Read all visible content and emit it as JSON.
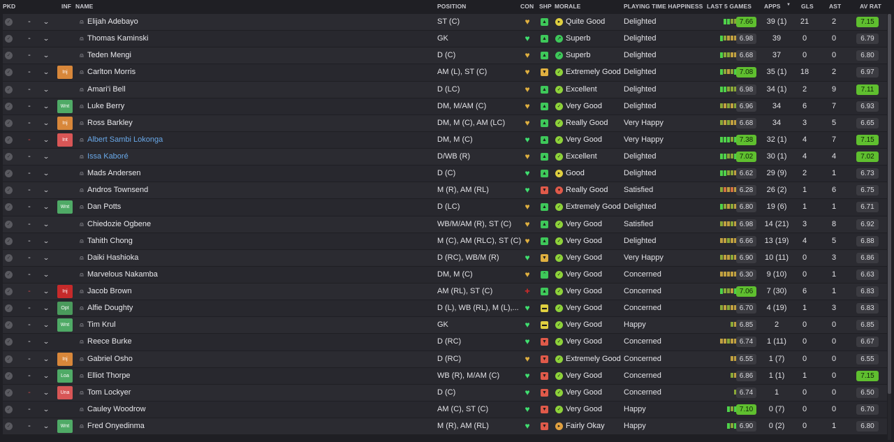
{
  "headers": {
    "pkd": "PKD",
    "inf": "INF",
    "name": "NAME",
    "position": "POSITION",
    "con": "CON",
    "shp": "SHP",
    "morale": "MORALE",
    "playing_time": "PLAYING TIME HAPPINESS",
    "last5": "LAST 5 GAMES",
    "apps": "APPS",
    "gls": "GLS",
    "ast": "AST",
    "av_rat": "AV RAT"
  },
  "colors": {
    "good_rating": "#5fbf2f",
    "form_high": "#4fd24a",
    "form_mid": "#8aa838",
    "form_low": "#c0a040",
    "form_bad": "#d07040",
    "condition_good": "#40e070",
    "condition_warn": "#e0b040",
    "injury_badge": "#d8873a",
    "wanted_badge": "#4faa66",
    "international_badge": "#d85656",
    "loaned_name": "#69a8e8"
  },
  "players": [
    {
      "pkd_dash": "-",
      "red": false,
      "inf": "",
      "name": "Elijah Adebayo",
      "loan": false,
      "position": "ST (C)",
      "con": "warn",
      "shp": "up",
      "morale_icon": "quite",
      "morale": "Quite Good",
      "playing_time": "Delighted",
      "last5": [
        "h",
        "h",
        "m",
        "m"
      ],
      "last_rating": "7.66",
      "last_good": true,
      "apps": "39 (1)",
      "gls": "21",
      "ast": "2",
      "avrat": "7.15",
      "av_good": true
    },
    {
      "pkd_dash": "-",
      "red": false,
      "inf": "",
      "name": "Thomas Kaminski",
      "loan": false,
      "position": "GK",
      "con": "good",
      "shp": "up",
      "morale_icon": "super",
      "morale": "Superb",
      "playing_time": "Delighted",
      "last5": [
        "h",
        "m",
        "l",
        "l",
        "l"
      ],
      "last_rating": "6.98",
      "last_good": false,
      "apps": "39",
      "gls": "0",
      "ast": "0",
      "avrat": "6.79",
      "av_good": false
    },
    {
      "pkd_dash": "-",
      "red": false,
      "inf": "",
      "name": "Teden Mengi",
      "loan": false,
      "position": "D (C)",
      "con": "warn",
      "shp": "up",
      "morale_icon": "super",
      "morale": "Superb",
      "playing_time": "Delighted",
      "last5": [
        "h",
        "m",
        "m",
        "l",
        "l"
      ],
      "last_rating": "6.68",
      "last_good": false,
      "apps": "37",
      "gls": "0",
      "ast": "0",
      "avrat": "6.80",
      "av_good": false
    },
    {
      "pkd_dash": "-",
      "red": false,
      "inf": "Inj",
      "inf_type": "inj",
      "name": "Carlton Morris",
      "loan": false,
      "position": "AM (L), ST (C)",
      "con": "warn",
      "shp": "warnup",
      "morale_icon": "good",
      "morale": "Extremely Good",
      "playing_time": "Delighted",
      "last5": [
        "h",
        "m",
        "l",
        "m",
        "h"
      ],
      "last_rating": "7.08",
      "last_good": true,
      "apps": "35 (1)",
      "gls": "18",
      "ast": "2",
      "avrat": "6.97",
      "av_good": false
    },
    {
      "pkd_dash": "-",
      "red": false,
      "inf": "",
      "name": "Amari'i Bell",
      "loan": false,
      "position": "D (LC)",
      "con": "warn",
      "shp": "up",
      "morale_icon": "good",
      "morale": "Excellent",
      "playing_time": "Delighted",
      "last5": [
        "h",
        "h",
        "m",
        "m",
        "m"
      ],
      "last_rating": "6.98",
      "last_good": false,
      "apps": "34 (1)",
      "gls": "2",
      "ast": "9",
      "avrat": "7.11",
      "av_good": true
    },
    {
      "pkd_dash": "-",
      "red": false,
      "inf": "Wnt",
      "inf_type": "wnt",
      "name": "Luke Berry",
      "loan": false,
      "position": "DM, M/AM (C)",
      "con": "warn",
      "shp": "up",
      "morale_icon": "good",
      "morale": "Very Good",
      "playing_time": "Delighted",
      "last5": [
        "m",
        "l",
        "m",
        "l",
        "m"
      ],
      "last_rating": "6.96",
      "last_good": false,
      "apps": "34",
      "gls": "6",
      "ast": "7",
      "avrat": "6.93",
      "av_good": false
    },
    {
      "pkd_dash": "-",
      "red": false,
      "inf": "Inj",
      "inf_type": "inj",
      "name": "Ross Barkley",
      "loan": false,
      "position": "DM, M (C), AM (LC)",
      "con": "warn",
      "shp": "up",
      "morale_icon": "good",
      "morale": "Really Good",
      "playing_time": "Very Happy",
      "last5": [
        "m",
        "l",
        "m",
        "l",
        "l"
      ],
      "last_rating": "6.68",
      "last_good": false,
      "apps": "34",
      "gls": "3",
      "ast": "5",
      "avrat": "6.65",
      "av_good": false
    },
    {
      "pkd_dash": "-",
      "red": true,
      "inf": "Int",
      "inf_type": "int",
      "name": "Albert Sambi Lokonga",
      "loan": true,
      "position": "DM, M (C)",
      "con": "good",
      "shp": "up",
      "morale_icon": "good",
      "morale": "Very Good",
      "playing_time": "Very Happy",
      "last5": [
        "h",
        "h",
        "h",
        "m",
        "h"
      ],
      "last_rating": "7.38",
      "last_good": true,
      "apps": "32 (1)",
      "gls": "4",
      "ast": "7",
      "avrat": "7.15",
      "av_good": true
    },
    {
      "pkd_dash": "-",
      "red": false,
      "inf": "",
      "name": "Issa Kaboré",
      "loan": true,
      "position": "D/WB (R)",
      "con": "warn",
      "shp": "up",
      "morale_icon": "good",
      "morale": "Excellent",
      "playing_time": "Delighted",
      "last5": [
        "h",
        "h",
        "m",
        "m",
        "h"
      ],
      "last_rating": "7.02",
      "last_good": true,
      "apps": "30 (1)",
      "gls": "4",
      "ast": "4",
      "avrat": "7.02",
      "av_good": true
    },
    {
      "pkd_dash": "-",
      "red": false,
      "inf": "",
      "name": "Mads Andersen",
      "loan": false,
      "position": "D (C)",
      "con": "good",
      "shp": "up",
      "morale_icon": "quite",
      "morale": "Good",
      "playing_time": "Delighted",
      "last5": [
        "h",
        "h",
        "m",
        "m",
        "l"
      ],
      "last_rating": "6.62",
      "last_good": false,
      "apps": "29 (9)",
      "gls": "2",
      "ast": "1",
      "avrat": "6.73",
      "av_good": false
    },
    {
      "pkd_dash": "-",
      "red": false,
      "inf": "",
      "name": "Andros Townsend",
      "loan": false,
      "position": "M (R), AM (RL)",
      "con": "good",
      "shp": "down",
      "morale_icon": "bad",
      "morale": "Really Good",
      "playing_time": "Satisfied",
      "last5": [
        "m",
        "b",
        "l",
        "b",
        "l"
      ],
      "last_rating": "6.28",
      "last_good": false,
      "apps": "26 (2)",
      "gls": "1",
      "ast": "6",
      "avrat": "6.75",
      "av_good": false
    },
    {
      "pkd_dash": "-",
      "red": false,
      "inf": "Wnt",
      "inf_type": "wnt",
      "name": "Dan Potts",
      "loan": false,
      "position": "D (LC)",
      "con": "warn",
      "shp": "up",
      "morale_icon": "good",
      "morale": "Extremely Good",
      "playing_time": "Delighted",
      "last5": [
        "h",
        "m",
        "l",
        "m",
        "l"
      ],
      "last_rating": "6.80",
      "last_good": false,
      "apps": "19 (6)",
      "gls": "1",
      "ast": "1",
      "avrat": "6.71",
      "av_good": false
    },
    {
      "pkd_dash": "-",
      "red": false,
      "inf": "",
      "name": "Chiedozie Ogbene",
      "loan": false,
      "position": "WB/M/AM (R), ST (C)",
      "con": "warn",
      "shp": "up",
      "morale_icon": "good",
      "morale": "Very Good",
      "playing_time": "Satisfied",
      "last5": [
        "m",
        "l",
        "l",
        "m",
        "l"
      ],
      "last_rating": "6.98",
      "last_good": false,
      "apps": "14 (21)",
      "gls": "3",
      "ast": "8",
      "avrat": "6.92",
      "av_good": false
    },
    {
      "pkd_dash": "-",
      "red": false,
      "inf": "",
      "name": "Tahith Chong",
      "loan": false,
      "position": "M (C), AM (RLC), ST (C)",
      "con": "warn",
      "shp": "up",
      "morale_icon": "good",
      "morale": "Very Good",
      "playing_time": "Delighted",
      "last5": [
        "l",
        "l",
        "m",
        "l",
        "l"
      ],
      "last_rating": "6.66",
      "last_good": false,
      "apps": "13 (19)",
      "gls": "4",
      "ast": "5",
      "avrat": "6.88",
      "av_good": false
    },
    {
      "pkd_dash": "-",
      "red": false,
      "inf": "",
      "name": "Daiki Hashioka",
      "loan": false,
      "position": "D (RC), WB/M (R)",
      "con": "good",
      "shp": "warnup",
      "morale_icon": "good",
      "morale": "Very Good",
      "playing_time": "Very Happy",
      "last5": [
        "m",
        "l",
        "l",
        "m",
        "l"
      ],
      "last_rating": "6.90",
      "last_good": false,
      "apps": "10 (11)",
      "gls": "0",
      "ast": "3",
      "avrat": "6.86",
      "av_good": false
    },
    {
      "pkd_dash": "-",
      "red": false,
      "inf": "",
      "name": "Marvelous Nakamba",
      "loan": false,
      "position": "DM, M (C)",
      "con": "warn",
      "shp": "upflat",
      "morale_icon": "good",
      "morale": "Very Good",
      "playing_time": "Concerned",
      "last5": [
        "l",
        "l",
        "l",
        "l",
        "l"
      ],
      "last_rating": "6.30",
      "last_good": false,
      "apps": "9 (10)",
      "gls": "0",
      "ast": "1",
      "avrat": "6.63",
      "av_good": false
    },
    {
      "pkd_dash": "-",
      "red": true,
      "inf": "Inj",
      "inf_type": "injred",
      "name": "Jacob Brown",
      "loan": false,
      "position": "AM (RL), ST (C)",
      "con": "injured",
      "shp": "up",
      "morale_icon": "good",
      "morale": "Very Good",
      "playing_time": "Concerned",
      "last5": [
        "h",
        "m",
        "m",
        "l",
        "h"
      ],
      "last_rating": "7.06",
      "last_good": true,
      "apps": "7 (30)",
      "gls": "6",
      "ast": "1",
      "avrat": "6.83",
      "av_good": false
    },
    {
      "pkd_dash": "-",
      "red": false,
      "inf": "Opt",
      "inf_type": "opt",
      "name": "Alfie Doughty",
      "loan": false,
      "position": "D (L), WB (RL), M (L),...",
      "con": "good",
      "shp": "flat",
      "morale_icon": "good",
      "morale": "Very Good",
      "playing_time": "Concerned",
      "last5": [
        "m",
        "l",
        "m",
        "l",
        "l"
      ],
      "last_rating": "6.70",
      "last_good": false,
      "apps": "4 (19)",
      "gls": "1",
      "ast": "3",
      "avrat": "6.83",
      "av_good": false
    },
    {
      "pkd_dash": "-",
      "red": false,
      "inf": "Wnt",
      "inf_type": "wnt",
      "name": "Tim Krul",
      "loan": false,
      "position": "GK",
      "con": "good",
      "shp": "flat",
      "morale_icon": "good",
      "morale": "Very Good",
      "playing_time": "Happy",
      "last5": [
        "m",
        "l"
      ],
      "last_rating": "6.85",
      "last_good": false,
      "apps": "2",
      "gls": "0",
      "ast": "0",
      "avrat": "6.85",
      "av_good": false
    },
    {
      "pkd_dash": "-",
      "red": false,
      "inf": "",
      "name": "Reece Burke",
      "loan": false,
      "position": "D (RC)",
      "con": "good",
      "shp": "down",
      "morale_icon": "good",
      "morale": "Very Good",
      "playing_time": "Concerned",
      "last5": [
        "l",
        "l",
        "m",
        "l",
        "l"
      ],
      "last_rating": "6.74",
      "last_good": false,
      "apps": "1 (11)",
      "gls": "0",
      "ast": "0",
      "avrat": "6.67",
      "av_good": false
    },
    {
      "pkd_dash": "-",
      "red": false,
      "inf": "Inj",
      "inf_type": "inj",
      "name": "Gabriel Osho",
      "loan": false,
      "position": "D (RC)",
      "con": "warn",
      "shp": "down",
      "morale_icon": "good",
      "morale": "Extremely Good",
      "playing_time": "Concerned",
      "last5": [
        "l",
        "l"
      ],
      "last_rating": "6.55",
      "last_good": false,
      "apps": "1 (7)",
      "gls": "0",
      "ast": "0",
      "avrat": "6.55",
      "av_good": false
    },
    {
      "pkd_dash": "-",
      "red": false,
      "inf": "Loa",
      "inf_type": "loa",
      "name": "Elliot Thorpe",
      "loan": false,
      "position": "WB (R), M/AM (C)",
      "con": "good",
      "shp": "down",
      "morale_icon": "good",
      "morale": "Very Good",
      "playing_time": "Concerned",
      "last5": [
        "m",
        "l"
      ],
      "last_rating": "6.86",
      "last_good": false,
      "apps": "1 (1)",
      "gls": "1",
      "ast": "0",
      "avrat": "7.15",
      "av_good": true
    },
    {
      "pkd_dash": "-",
      "red": true,
      "inf": "Una",
      "inf_type": "una",
      "name": "Tom Lockyer",
      "loan": false,
      "position": "D (C)",
      "con": "good",
      "shp": "down",
      "morale_icon": "good",
      "morale": "Very Good",
      "playing_time": "Concerned",
      "last5": [
        "m"
      ],
      "last_rating": "6.74",
      "last_good": false,
      "apps": "1",
      "gls": "0",
      "ast": "0",
      "avrat": "6.50",
      "av_good": false
    },
    {
      "pkd_dash": "-",
      "red": false,
      "inf": "",
      "name": "Cauley Woodrow",
      "loan": false,
      "position": "AM (C), ST (C)",
      "con": "good",
      "shp": "down",
      "morale_icon": "good",
      "morale": "Very Good",
      "playing_time": "Happy",
      "last5": [
        "h",
        "m",
        "h"
      ],
      "last_rating": "7.10",
      "last_good": true,
      "apps": "0 (7)",
      "gls": "0",
      "ast": "0",
      "avrat": "6.70",
      "av_good": false
    },
    {
      "pkd_dash": "-",
      "red": false,
      "inf": "Wnt",
      "inf_type": "wnt",
      "name": "Fred Onyedinma",
      "loan": false,
      "position": "M (R), AM (RL)",
      "con": "good",
      "shp": "down",
      "morale_icon": "okay",
      "morale": "Fairly Okay",
      "playing_time": "Happy",
      "last5": [
        "h",
        "m",
        "h"
      ],
      "last_rating": "6.90",
      "last_good": false,
      "apps": "0 (2)",
      "gls": "0",
      "ast": "1",
      "avrat": "6.80",
      "av_good": false
    }
  ]
}
